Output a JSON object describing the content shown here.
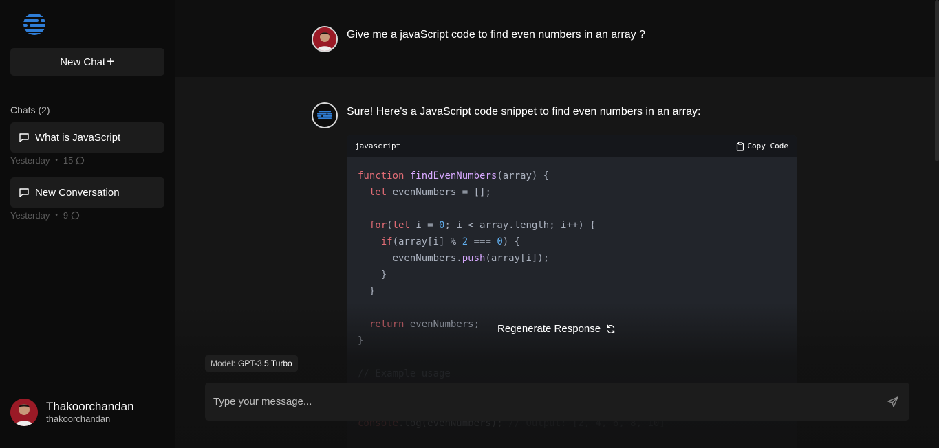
{
  "sidebar": {
    "logo_icon": "brand-logo-icon",
    "new_chat_label": "New Chat",
    "new_chat_icon": "plus-icon",
    "chats_heading": "Chats (2)",
    "chats": [
      {
        "title": "What is JavaScript",
        "date": "Yesterday",
        "count": "15"
      },
      {
        "title": "New Conversation",
        "date": "Yesterday",
        "count": "9"
      }
    ],
    "profile": {
      "name": "Thakoorchandan",
      "handle": "thakoorchandan"
    }
  },
  "conversation": {
    "user_message": "Give me a javaScript code to find even numbers in an array ?",
    "bot_message": "Sure! Here's a JavaScript code snippet to find even numbers in an array:",
    "code": {
      "language": "javascript",
      "copy_label": "Copy Code"
    }
  },
  "footer": {
    "regenerate_label": "Regenerate Response",
    "model_label": "Model:",
    "model_value": "GPT-3.5 Turbo",
    "input_placeholder": "Type your message..."
  },
  "colors": {
    "accent_blue": "#2f7ed8",
    "keyword": "#e06c75",
    "function": "#d7a8ff",
    "number": "#61afef"
  }
}
